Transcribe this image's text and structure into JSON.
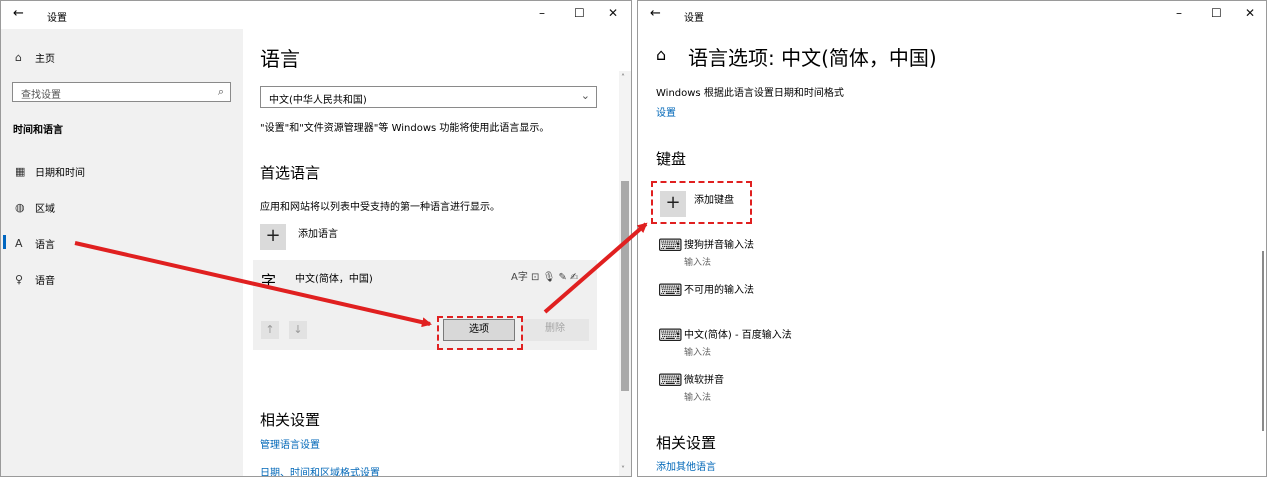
{
  "window1": {
    "title": "设置",
    "back": "←",
    "controls": {
      "minimize": "–",
      "maximize": "☐",
      "close": "✕"
    },
    "sidebar": {
      "home": "主页",
      "search_placeholder": "查找设置",
      "section": "时间和语言",
      "items": [
        {
          "label": "日期和时间",
          "icon": "calendar-clock-icon"
        },
        {
          "label": "区域",
          "icon": "globe-icon"
        },
        {
          "label": "语言",
          "icon": "language-icon"
        },
        {
          "label": "语音",
          "icon": "microphone-icon"
        }
      ]
    },
    "main": {
      "heading": "语言",
      "display_language": "中文(中华人民共和国)",
      "display_note": "\"设置\"和\"文件资源管理器\"等 Windows 功能将使用此语言显示。",
      "preferred_heading": "首选语言",
      "preferred_desc": "应用和网站将以列表中受支持的第一种语言进行显示。",
      "add_language": "添加语言",
      "lang_entry": "中文(简体，中国)",
      "lang_glyph": "字",
      "feature_icons": "A字 ⊡ 🎙 ✎ ✍",
      "options_button": "选项",
      "remove_button": "删除",
      "related_heading": "相关设置",
      "related_link1": "管理语言设置",
      "related_link2": "日期、时间和区域格式设置"
    }
  },
  "window2": {
    "title": "设置",
    "back": "←",
    "controls": {
      "minimize": "–",
      "maximize": "☐",
      "close": "✕"
    },
    "heading": "语言选项: 中文(简体，中国)",
    "region_note": "Windows 根据此语言设置日期和时间格式",
    "settings_link": "设置",
    "keyboard_heading": "键盘",
    "add_keyboard": "添加键盘",
    "keyboards": [
      {
        "name": "搜狗拼音输入法",
        "type": "输入法"
      },
      {
        "name": "不可用的输入法",
        "type": ""
      },
      {
        "name": "中文(简体) - 百度输入法",
        "type": "输入法"
      },
      {
        "name": "微软拼音",
        "type": "输入法"
      }
    ],
    "related_heading": "相关设置",
    "related_link": "添加其他语言"
  },
  "colors": {
    "accent": "#0067b8",
    "highlight": "#e02020",
    "sidebar_bg": "#f1f1f1"
  }
}
